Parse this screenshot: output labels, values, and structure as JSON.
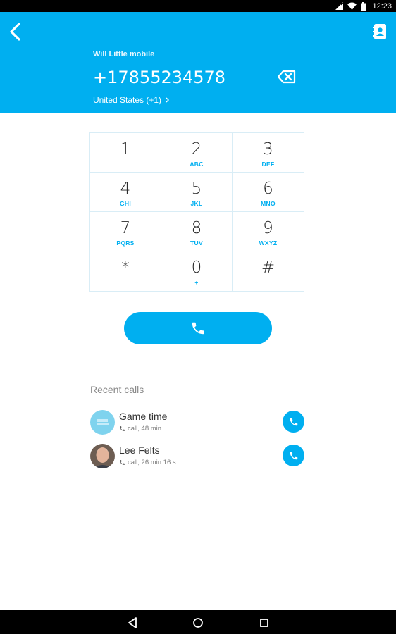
{
  "status_bar": {
    "time": "12:23",
    "icons": [
      "signal-icon",
      "wifi-icon",
      "battery-icon"
    ]
  },
  "header": {
    "contact_name": "Will Little mobile",
    "number": "+17855234578",
    "country": "United States (+1)",
    "icons": [
      "back-icon",
      "contacts-icon",
      "backspace-icon"
    ]
  },
  "keypad": {
    "keys": [
      {
        "digit": "1",
        "letters": ""
      },
      {
        "digit": "2",
        "letters": "ABC"
      },
      {
        "digit": "3",
        "letters": "DEF"
      },
      {
        "digit": "4",
        "letters": "GHI"
      },
      {
        "digit": "5",
        "letters": "JKL"
      },
      {
        "digit": "6",
        "letters": "MNO"
      },
      {
        "digit": "7",
        "letters": "PQRS"
      },
      {
        "digit": "8",
        "letters": "TUV"
      },
      {
        "digit": "9",
        "letters": "WXYZ"
      },
      {
        "digit": "*",
        "letters": ""
      },
      {
        "digit": "0",
        "letters": "+"
      },
      {
        "digit": "#",
        "letters": ""
      }
    ]
  },
  "call_button_icon": "phone-icon",
  "recent": {
    "title": "Recent calls",
    "items": [
      {
        "name": "Game time",
        "meta": "call, 48 min"
      },
      {
        "name": "Lee Felts",
        "meta": "call, 26 min 16 s"
      }
    ]
  },
  "nav_bar": {
    "icons": [
      "nav-back-icon",
      "home-icon",
      "recents-icon"
    ]
  },
  "colors": {
    "accent": "#00aff0",
    "text": "#333333",
    "muted": "#8a8a8a"
  }
}
